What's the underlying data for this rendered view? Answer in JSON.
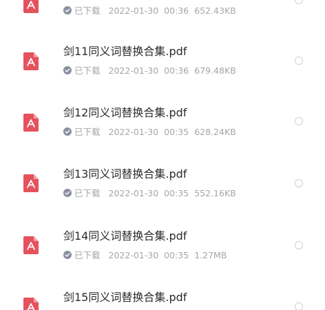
{
  "files": [
    {
      "name": "",
      "status": "已下载",
      "date": "2022-01-30",
      "time": "00:36",
      "size": "652.43KB"
    },
    {
      "name": "剑11同义词替换合集.pdf",
      "status": "已下载",
      "date": "2022-01-30",
      "time": "00:36",
      "size": "679.48KB"
    },
    {
      "name": "剑12同义词替换合集.pdf",
      "status": "已下载",
      "date": "2022-01-30",
      "time": "00:35",
      "size": "628.24KB"
    },
    {
      "name": "剑13同义词替换合集.pdf",
      "status": "已下载",
      "date": "2022-01-30",
      "time": "00:35",
      "size": "552.16KB"
    },
    {
      "name": "剑14同义词替换合集.pdf",
      "status": "已下载",
      "date": "2022-01-30",
      "time": "00:35",
      "size": "1.27MB"
    },
    {
      "name": "剑15同义词替换合集.pdf",
      "status": "",
      "date": "",
      "time": "",
      "size": ""
    }
  ],
  "colors": {
    "pdf_icon": "#e4525d",
    "check_icon": "#8a8fa0",
    "meta_text": "#a6a6a6"
  },
  "icons": {
    "file": "pdf-icon",
    "status": "check-circle-icon",
    "select": "radio-circle-icon"
  }
}
